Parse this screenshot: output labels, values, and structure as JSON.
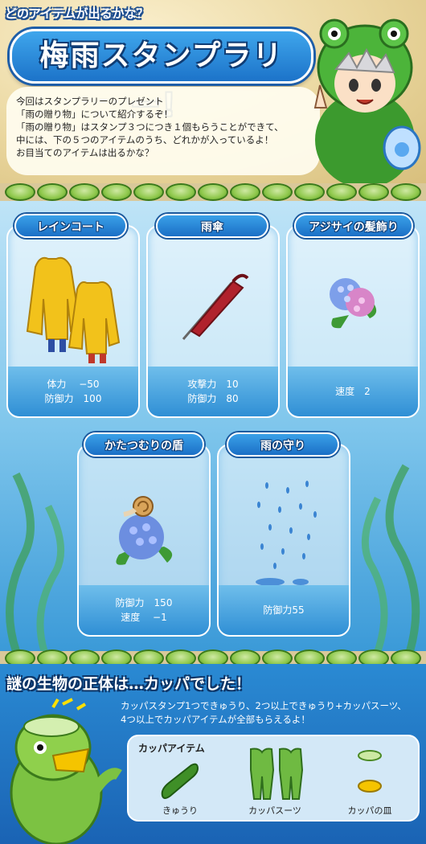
{
  "header": {
    "subtitle": "どのアイテムが出るかな？",
    "title": "梅雨スタンプラリー！",
    "intro": [
      "今回はスタンプラリーのプレゼント",
      "「雨の贈り物」について紹介するぞ！",
      "「雨の贈り物」はスタンプ３つにつき１個もらうことができて、",
      "中には、下の５つのアイテムのうち、どれかが入っているよ！",
      "お目当てのアイテムは出るかな？"
    ]
  },
  "items": [
    {
      "name": "レインコート",
      "icon": "raincoat-icon",
      "stats": [
        "体力　 −50",
        "防御力　100"
      ]
    },
    {
      "name": "雨傘",
      "icon": "umbrella-icon",
      "stats": [
        "攻撃力　10",
        "防御力　80"
      ]
    },
    {
      "name": "アジサイの髪飾り",
      "icon": "hydrangea-icon",
      "stats": [
        "速度　2"
      ]
    },
    {
      "name": "かたつむりの盾",
      "icon": "snail-shield-icon",
      "stats": [
        "防御力　150",
        "速度　 −1"
      ]
    },
    {
      "name": "雨の守り",
      "icon": "raindrops-icon",
      "stats": [
        "防御力55"
      ]
    }
  ],
  "kappa": {
    "title": "謎の生物の正体は…カッパでした！",
    "desc": [
      "カッパスタンプ1つできゅうり、2つ以上できゅうり+カッパスーツ、",
      "4つ以上でカッパアイテムが全部もらえるよ！"
    ],
    "box_label": "カッパアイテム",
    "items": [
      {
        "name": "きゅうり",
        "icon": "cucumber-icon"
      },
      {
        "name": "カッパスーツ",
        "icon": "kappa-suit-icon"
      },
      {
        "name": "カッパの皿",
        "icon": "kappa-plate-icon"
      }
    ]
  },
  "colors": {
    "accent_blue": "#1c73c9",
    "lily_green": "#8fc84c",
    "raincoat_yellow": "#f2c21b"
  }
}
